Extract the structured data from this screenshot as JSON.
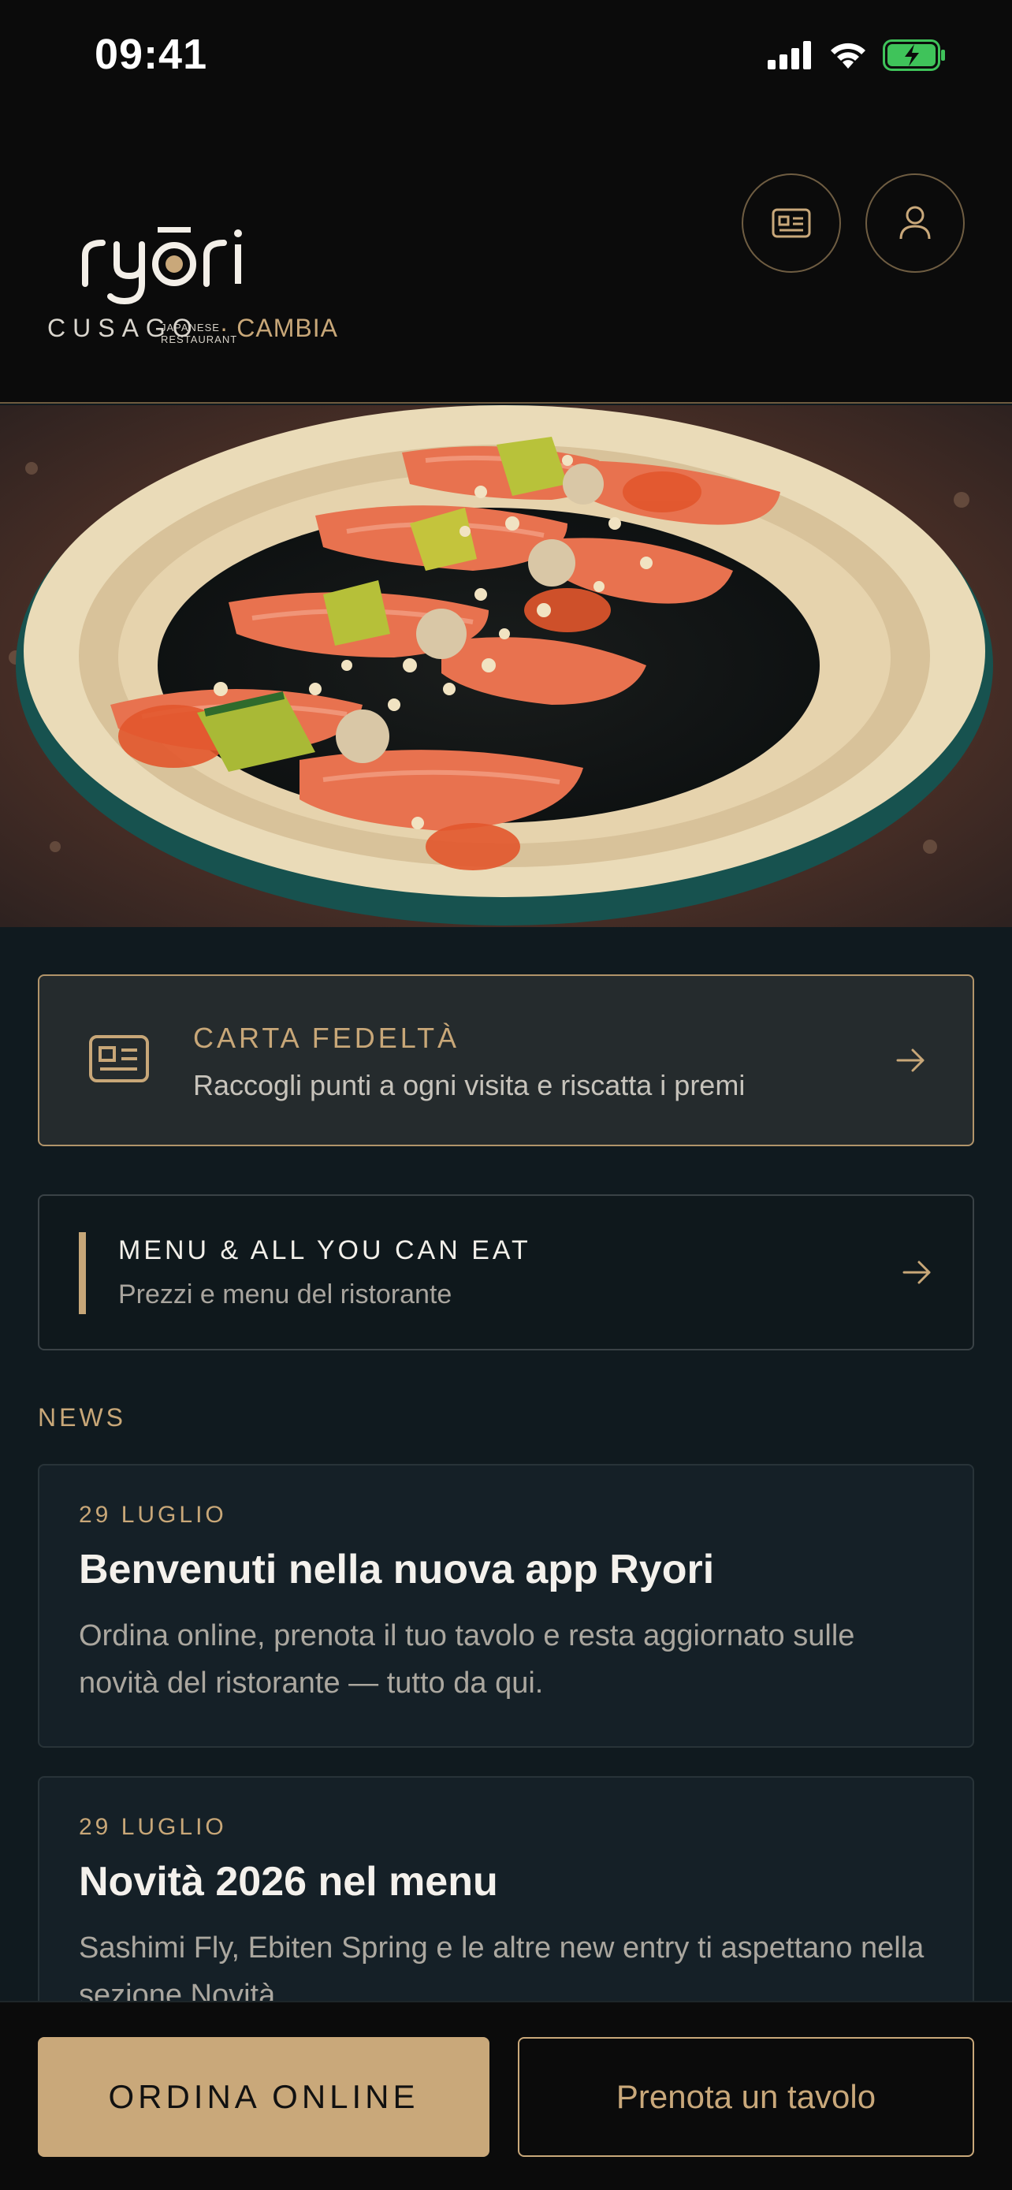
{
  "status_bar": {
    "time": "09:41",
    "icons": [
      "cellular-signal-icon",
      "wifi-icon",
      "battery-charging-icon"
    ]
  },
  "header": {
    "logo_text": "ryōri",
    "logo_subtitle": "JAPANESE RESTAURANT",
    "card_button_icon": "loyalty-card-icon",
    "profile_button_icon": "user-icon",
    "location_name": "CUSAGO",
    "location_change": "· CAMBIA"
  },
  "hero": {
    "image_subject": "salmon-sashimi-dish"
  },
  "loyalty": {
    "title": "CARTA FEDELTÀ",
    "subtitle": "Raccogli punti a ogni visita e riscatta i premi",
    "icon": "loyalty-card-icon"
  },
  "menu": {
    "title": "MENU & ALL YOU CAN EAT",
    "subtitle": "Prezzi e menu del ristorante"
  },
  "news": {
    "label": "NEWS",
    "items": [
      {
        "date": "29 LUGLIO",
        "title": "Benvenuti nella nuova app Ryori",
        "body": "Ordina online, prenota il tuo tavolo e resta aggiornato sulle novità del ristorante — tutto da qui."
      },
      {
        "date": "29 LUGLIO",
        "title": "Novità 2026 nel menu",
        "body": "Sashimi Fly, Ebiten Spring e le altre new entry ti aspettano nella sezione Novità."
      }
    ]
  },
  "bottom_bar": {
    "order_label": "ORDINA ONLINE",
    "book_label": "Prenota un tavolo"
  },
  "colors": {
    "accent": "#c9a87a",
    "background": "#101a1f",
    "header_background": "#0b0b0b",
    "battery": "#3fc35a"
  }
}
